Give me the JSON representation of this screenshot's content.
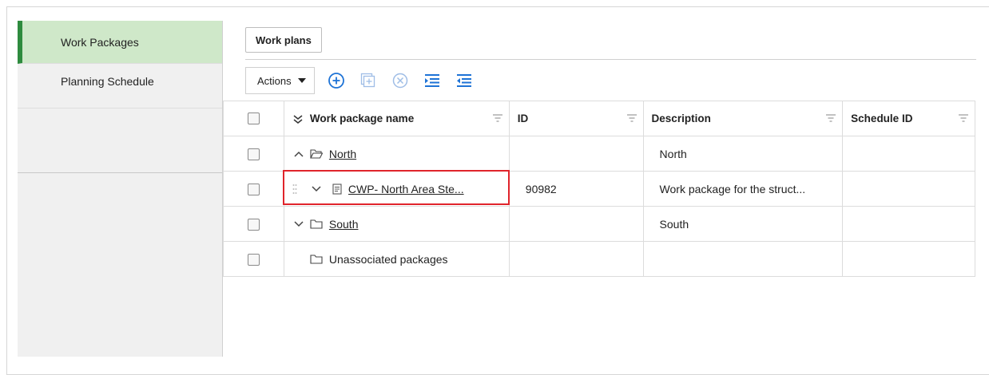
{
  "sidebar": {
    "items": [
      {
        "label": "Work Packages",
        "active": true
      },
      {
        "label": "Planning Schedule",
        "active": false
      }
    ]
  },
  "tabs": [
    {
      "label": "Work plans"
    }
  ],
  "toolbar": {
    "actions_label": "Actions",
    "icons": [
      "add-circle-icon",
      "add-square-icon",
      "remove-circle-icon",
      "indent-icon",
      "outdent-icon"
    ]
  },
  "table": {
    "columns": [
      "Work package name",
      "ID",
      "Description",
      "Schedule ID"
    ],
    "rows": [
      {
        "name": "North",
        "id": "",
        "description": "North",
        "schedule_id": ""
      },
      {
        "name": "CWP- North Area Ste...",
        "id": "90982",
        "description": "Work package for the struct...",
        "schedule_id": ""
      },
      {
        "name": "South",
        "id": "",
        "description": "South",
        "schedule_id": ""
      },
      {
        "name": "Unassociated packages",
        "id": "",
        "description": "",
        "schedule_id": ""
      }
    ]
  },
  "colors": {
    "accent": "#2e8b3e",
    "active_bg": "#cfe8c9",
    "toolbar_blue": "#1e73d6",
    "highlight": "#e0242b"
  }
}
